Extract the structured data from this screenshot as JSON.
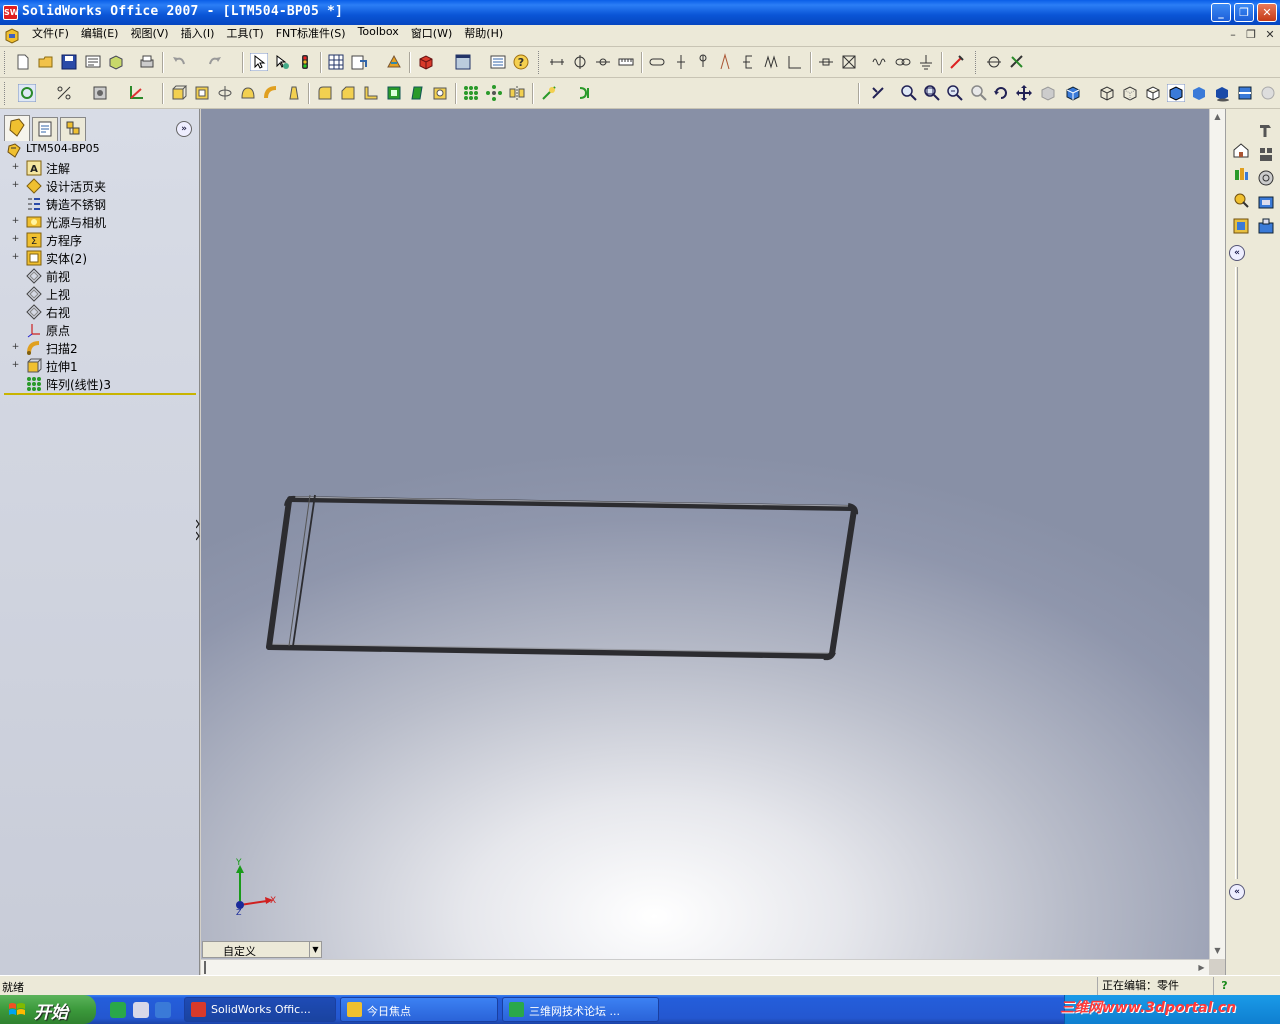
{
  "window": {
    "title": "SolidWorks Office 2007 - [LTM504-BP05 *]",
    "app_icon_text": "SW",
    "minimize_label": "_",
    "restore_label": "❐",
    "close_label": "✕"
  },
  "menubar": {
    "items": [
      "文件(F)",
      "编辑(E)",
      "视图(V)",
      "插入(I)",
      "工具(T)",
      "FNT标准件(S)",
      "Toolbox",
      "窗口(W)",
      "帮助(H)"
    ],
    "doc_min": "–",
    "doc_restore": "❐",
    "doc_close": "✕"
  },
  "feature_manager": {
    "collapse_label": "»",
    "root": "LTM504-BP05",
    "items": [
      {
        "label": "注解",
        "expand": "+",
        "icon": "annotations-icon"
      },
      {
        "label": "设计活页夹",
        "expand": "+",
        "icon": "design-binder-icon"
      },
      {
        "label": "铸造不锈钢",
        "expand": "",
        "icon": "material-icon"
      },
      {
        "label": "光源与相机",
        "expand": "+",
        "icon": "lights-cameras-icon"
      },
      {
        "label": "方程序",
        "expand": "+",
        "icon": "equations-icon"
      },
      {
        "label": "实体(2)",
        "expand": "+",
        "icon": "solid-bodies-icon"
      },
      {
        "label": "前视",
        "expand": "",
        "icon": "plane-icon"
      },
      {
        "label": "上视",
        "expand": "",
        "icon": "plane-icon"
      },
      {
        "label": "右视",
        "expand": "",
        "icon": "plane-icon"
      },
      {
        "label": "原点",
        "expand": "",
        "icon": "origin-icon"
      },
      {
        "label": "扫描2",
        "expand": "+",
        "icon": "sweep-icon"
      },
      {
        "label": "拉伸1",
        "expand": "+",
        "icon": "extrude-icon"
      },
      {
        "label": "阵列(线性)3",
        "expand": "",
        "icon": "linear-pattern-icon"
      }
    ]
  },
  "viewport": {
    "triad": {
      "x_label": "X",
      "y_label": "Y",
      "z_label": "Z"
    }
  },
  "configuration": {
    "value": "自定义"
  },
  "statusbar": {
    "ready": "就绪",
    "editing": "正在编辑：零件",
    "help": "?"
  },
  "taskbar": {
    "start_label": "开始",
    "tasks": [
      {
        "label": "SolidWorks Offic...",
        "icon": "solidworks-icon"
      },
      {
        "label": "今日焦点",
        "icon": "news-icon"
      },
      {
        "label": "三维网技术论坛 ...",
        "icon": "ie-icon"
      }
    ],
    "watermark": "三维网www.3dportal.cn"
  },
  "colors": {
    "titlebar": "#0a55d6",
    "model_edge": "#2a2a2e",
    "rollback_bar": "#c8b400"
  }
}
